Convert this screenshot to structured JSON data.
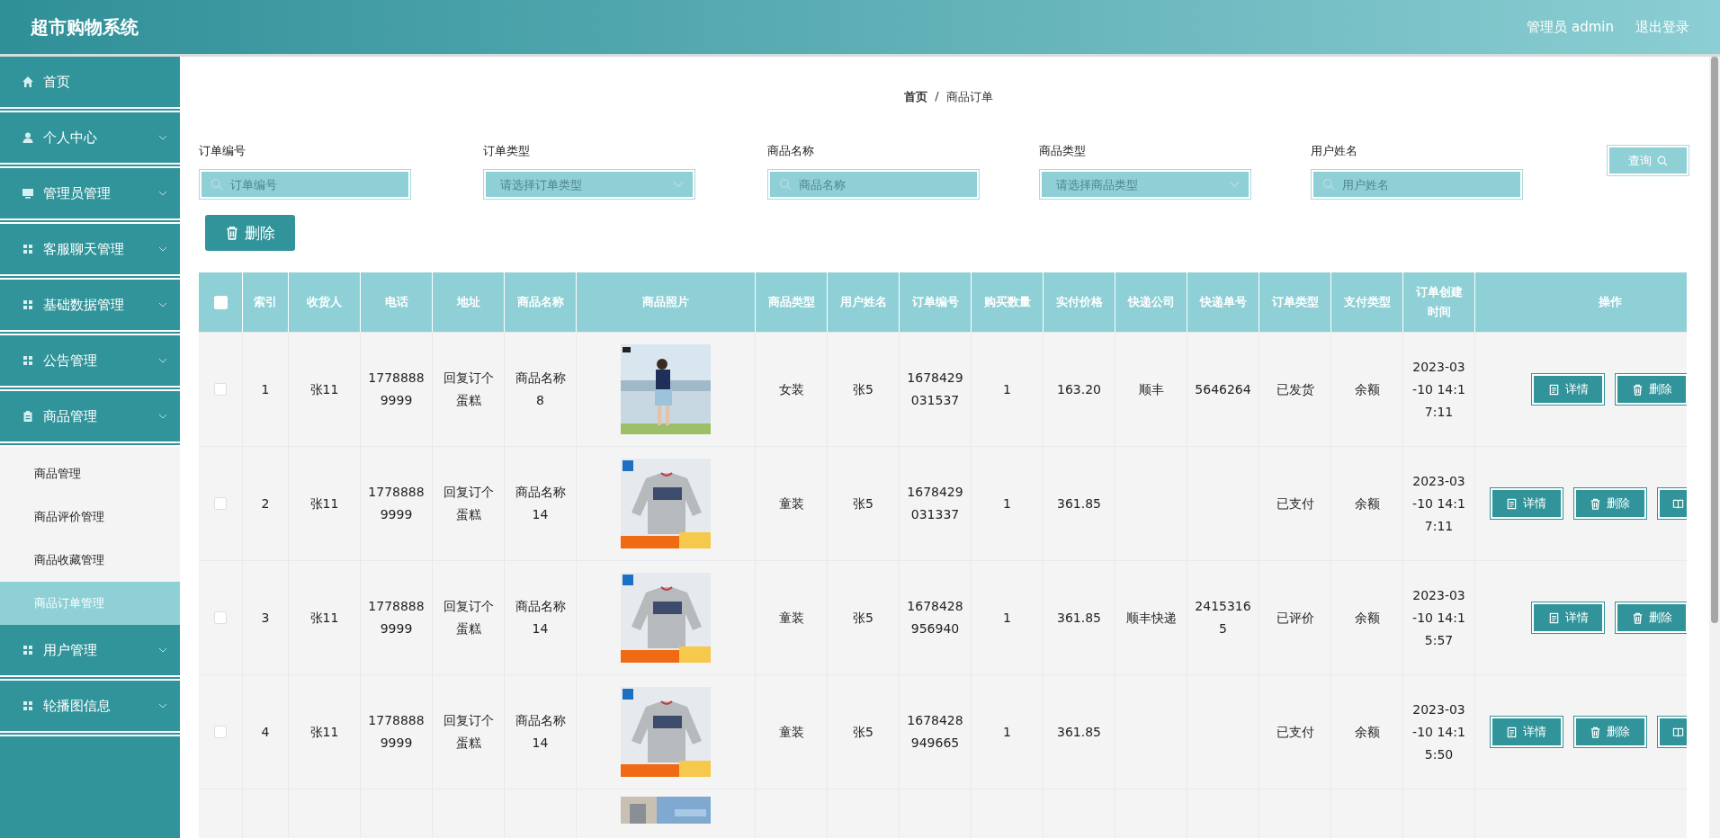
{
  "header": {
    "title": "超市购物系统",
    "user": "管理员 admin",
    "logout": "退出登录"
  },
  "sidebar": {
    "items": [
      {
        "label": "首页"
      },
      {
        "label": "个人中心"
      },
      {
        "label": "管理员管理"
      },
      {
        "label": "客服聊天管理"
      },
      {
        "label": "基础数据管理"
      },
      {
        "label": "公告管理"
      },
      {
        "label": "商品管理",
        "expanded": true,
        "children": [
          {
            "label": "商品管理",
            "selected": false
          },
          {
            "label": "商品评价管理",
            "selected": false
          },
          {
            "label": "商品收藏管理",
            "selected": false
          },
          {
            "label": "商品订单管理",
            "selected": true
          }
        ]
      },
      {
        "label": "用户管理"
      },
      {
        "label": "轮播图信息"
      }
    ]
  },
  "breadcrumb": [
    "首页",
    "/",
    "商品订单"
  ],
  "filters": [
    {
      "kind": "text",
      "label": "订单编号",
      "placeholder": "订单编号"
    },
    {
      "kind": "select",
      "label": "订单类型",
      "placeholder": "请选择订单类型"
    },
    {
      "kind": "text",
      "label": "商品名称",
      "placeholder": "商品名称"
    },
    {
      "kind": "select",
      "label": "商品类型",
      "placeholder": "请选择商品类型"
    },
    {
      "kind": "text",
      "label": "用户姓名",
      "placeholder": "用户姓名"
    }
  ],
  "query_button": "查询",
  "delete_button": "删除",
  "table": {
    "select_all": {
      "checked": false
    },
    "columns": [
      "索引",
      "收货人",
      "电话",
      "地址",
      "商品名称",
      "商品照片",
      "商品类型",
      "用户姓名",
      "订单编号",
      "购买数量",
      "实付价格",
      "快递公司",
      "快递单号",
      "订单类型",
      "支付类型",
      "订单创建时间",
      "操作"
    ],
    "rows": [
      {
        "checked": false,
        "cells": [
          "1",
          "张11",
          "17788889999",
          "回复订个蛋糕",
          "商品名称8",
          null,
          "女装",
          "张5",
          "1678429031537",
          "1",
          "163.20",
          "顺丰",
          "5646264",
          "已发货",
          "余额",
          "2023-03-10 14:17:11"
        ],
        "actions": [
          {
            "kind": "detail",
            "label": "详情"
          },
          {
            "kind": "delete",
            "label": "删除"
          }
        ]
      },
      {
        "checked": false,
        "cells": [
          "2",
          "张11",
          "17788889999",
          "回复订个蛋糕",
          "商品名称14",
          null,
          "童装",
          "张5",
          "1678429031337",
          "1",
          "361.85",
          "",
          "",
          "已支付",
          "余额",
          "2023-03-10 14:17:11"
        ],
        "actions": [
          {
            "kind": "detail",
            "label": "详情"
          },
          {
            "kind": "delete",
            "label": "删除"
          },
          {
            "kind": "review"
          }
        ]
      },
      {
        "checked": false,
        "cells": [
          "3",
          "张11",
          "17788889999",
          "回复订个蛋糕",
          "商品名称14",
          null,
          "童装",
          "张5",
          "1678428956940",
          "1",
          "361.85",
          "顺丰快递",
          "24153165",
          "已评价",
          "余额",
          "2023-03-10 14:15:57"
        ],
        "actions": [
          {
            "kind": "detail",
            "label": "详情"
          },
          {
            "kind": "delete",
            "label": "删除"
          }
        ]
      },
      {
        "checked": false,
        "cells": [
          "4",
          "张11",
          "17788889999",
          "回复订个蛋糕",
          "商品名称14",
          null,
          "童装",
          "张5",
          "1678428949665",
          "1",
          "361.85",
          "",
          "",
          "已支付",
          "余额",
          "2023-03-10 14:15:50"
        ],
        "actions": [
          {
            "kind": "detail",
            "label": "详情"
          },
          {
            "kind": "delete",
            "label": "删除"
          },
          {
            "kind": "review"
          }
        ]
      }
    ]
  }
}
